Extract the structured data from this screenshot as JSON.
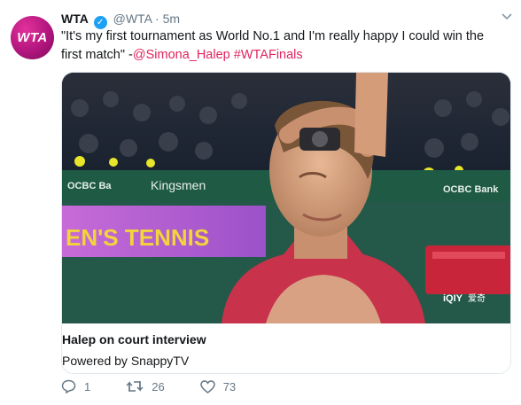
{
  "tweet": {
    "display_name": "WTA",
    "handle": "@WTA",
    "separator": "·",
    "time": "5m",
    "avatar_text": "WTA",
    "text_prefix": "\"It's my first tournament as World No.1 and I'm really happy I could win the first match\" -",
    "mention": "@Simona_Halep",
    "hashtag": "#WTAFinals"
  },
  "card": {
    "title": "Halep on court interview",
    "subtitle": "Powered by SnappyTV",
    "banner_text": "EN'S TENNIS",
    "sponsor_left": "OCBC Ba",
    "sponsor_mid": "Kingsmen",
    "sponsor_right": "OCBC Bank",
    "logo_text": "iQIY",
    "logo_side": "爱奇"
  },
  "actions": {
    "reply_count": "1",
    "retweet_count": "26",
    "like_count": "73"
  },
  "colors": {
    "accent": "#e0245e",
    "verified": "#1da1f2",
    "muted": "#657786"
  },
  "icons": [
    "verified-badge-icon",
    "chevron-down-icon",
    "reply-icon",
    "retweet-icon",
    "like-icon"
  ]
}
